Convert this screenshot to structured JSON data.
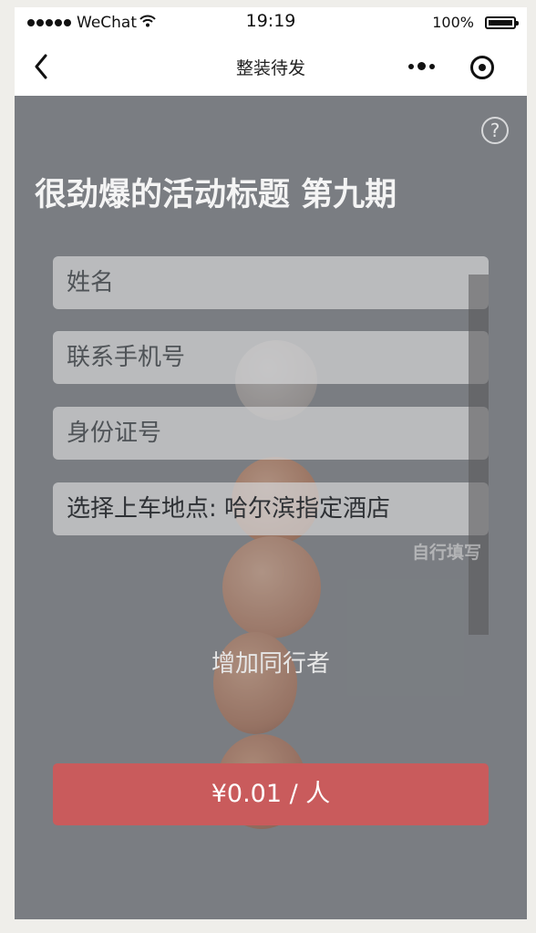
{
  "status_bar": {
    "carrier": "WeChat",
    "time": "19:19",
    "battery": "100%"
  },
  "nav": {
    "title": "整装待发"
  },
  "content": {
    "event_title": "很劲爆的活动标题 第九期",
    "help_symbol": "?",
    "fields": [
      {
        "placeholder": "姓名"
      },
      {
        "placeholder": "联系手机号"
      },
      {
        "placeholder": "身份证号"
      },
      {
        "value": "选择上车地点: 哈尔滨指定酒店"
      }
    ],
    "self_fill_label": "自行填写",
    "add_companion_label": "增加同行者",
    "price_button_label": "¥0.01 / 人"
  },
  "colors": {
    "pay_button": "#c95b5c",
    "overlay": "#7c7f83"
  }
}
